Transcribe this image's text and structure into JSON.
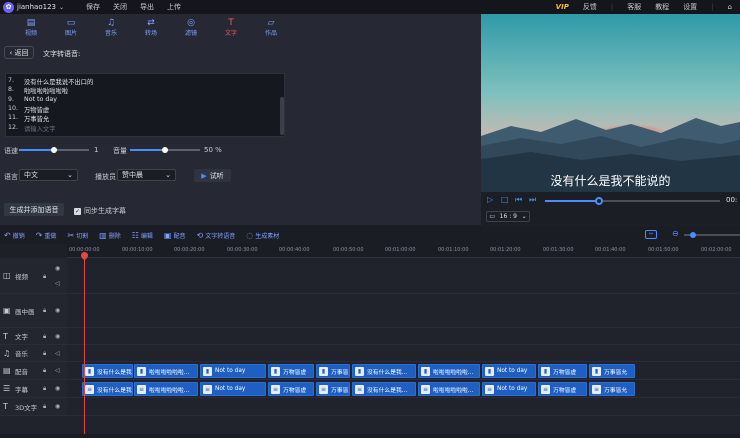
{
  "topbar": {
    "username": "jianhao123",
    "menu": [
      "保存",
      "关闭",
      "导出",
      "上传"
    ],
    "vip": "VIP",
    "right": [
      "反馈",
      "客服",
      "教程",
      "设置"
    ]
  },
  "tabs": [
    {
      "label": "视频",
      "icon": "film-icon"
    },
    {
      "label": "图片",
      "icon": "image-icon"
    },
    {
      "label": "音乐",
      "icon": "music-icon"
    },
    {
      "label": "转场",
      "icon": "transition-icon"
    },
    {
      "label": "滤镜",
      "icon": "filter-icon"
    },
    {
      "label": "文字",
      "icon": "text-icon"
    },
    {
      "label": "作品",
      "icon": "folder-icon"
    }
  ],
  "panel": {
    "back_label": "返回",
    "title": "文字转语音:",
    "lines": [
      {
        "n": "7.",
        "text": "没有什么是我说不出口的"
      },
      {
        "n": "8.",
        "text": "啦啦啦啦啦啦啦"
      },
      {
        "n": "9.",
        "text": "Not to day"
      },
      {
        "n": "10.",
        "text": "万物皆虚"
      },
      {
        "n": "11.",
        "text": "万事皆允"
      },
      {
        "n": "12.",
        "text": "请输入文字"
      }
    ],
    "speed_label": "语速",
    "speed_value": "1",
    "speed_fraction": 0.5,
    "volume_label": "音量",
    "volume_value": "50 %",
    "volume_fraction": 0.5,
    "language_label": "语言",
    "language_value": "中文",
    "speaker_label": "播放员",
    "speaker_value": "赞中晨",
    "trial_label": "试听",
    "generate_label": "生成并添加语音",
    "sync_label": "同步生成字幕"
  },
  "preview": {
    "subtitle": "没有什么是我不能说的",
    "time": "00:",
    "aspect": "16 : 9",
    "progress_fraction": 0.3
  },
  "toolbar": [
    {
      "label": "撤销",
      "icon": "undo-icon"
    },
    {
      "label": "重做",
      "icon": "redo-icon"
    },
    {
      "label": "切割",
      "icon": "scissors-icon"
    },
    {
      "label": "删除",
      "icon": "trash-icon"
    },
    {
      "label": "编辑",
      "icon": "edit-icon"
    },
    {
      "label": "配音",
      "icon": "mic-icon"
    },
    {
      "label": "文字转语音",
      "icon": "text-to-speech-icon"
    },
    {
      "label": "生成素材",
      "icon": "generate-icon"
    }
  ],
  "ruler": [
    "00:00:00:00",
    "00:00:10:00",
    "00:00:20:00",
    "00:00:30:00",
    "00:00:40:00",
    "00:00:50:00",
    "00:01:00:00",
    "00:01:10:00",
    "00:01:20:00",
    "00:01:30:00",
    "00:01:40:00",
    "00:01:50:00",
    "00:02:00:00"
  ],
  "tracks": [
    {
      "label": "视频",
      "icon": "video-track-icon"
    },
    {
      "label": "画中画",
      "icon": "pip-track-icon"
    },
    {
      "label": "文字",
      "icon": "text-track-icon"
    },
    {
      "label": "音乐",
      "icon": "music-track-icon"
    },
    {
      "label": "配音",
      "icon": "dubbing-track-icon"
    },
    {
      "label": "字幕",
      "icon": "subtitle-track-icon"
    },
    {
      "label": "3D文字",
      "icon": "3d-text-track-icon"
    }
  ],
  "dub_clips": [
    "没有什么是我...",
    "啦啦啦啦啦啦...",
    "Not to day",
    "万物皆虚",
    "万事皆允",
    "没有什么是我...",
    "啦啦啦啦啦啦...",
    "Not to day",
    "万物皆虚",
    "万事皆允"
  ],
  "sub_clips": [
    "没有什么是我...",
    "啦啦啦啦啦啦...",
    "Not to day",
    "万物皆虚",
    "万事皆允",
    "没有什么是我...",
    "啦啦啦啦啦啦...",
    "Not to day",
    "万物皆虚",
    "万事皆允"
  ]
}
